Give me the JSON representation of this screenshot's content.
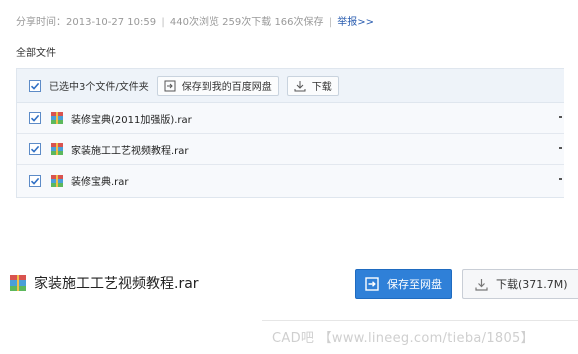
{
  "meta": {
    "share_time": "分享时间：2013-10-27 10:59",
    "views": "440次浏览",
    "downloads": "259次下载",
    "saves": "166次保存",
    "separator": "|",
    "report_link": "举报>>"
  },
  "section_label": "全部文件",
  "panel": {
    "selection_text": "已选中3个文件/文件夹",
    "save_to_pan_label": "保存到我的百度网盘",
    "download_label": "下载"
  },
  "files": [
    {
      "name": "装修宝典(2011加强版).rar"
    },
    {
      "name": "家装施工工艺视频教程.rar"
    },
    {
      "name": "装修宝典.rar"
    }
  ],
  "detail": {
    "file_name": "家装施工工艺视频教程.rar",
    "save_button_label": "保存至网盘",
    "download_button_label": "下载(371.7M)"
  },
  "watermark": "CAD吧 【www.lineeg.com/tieba/1805】",
  "colors": {
    "accent": "#2f80d8",
    "link": "#2a5db0",
    "checkbox": "#5d8bc7"
  },
  "icons": {
    "checkbox": "checkmark-icon",
    "save": "save-to-pan-icon",
    "download": "download-icon",
    "file": "rar-archive-icon"
  }
}
